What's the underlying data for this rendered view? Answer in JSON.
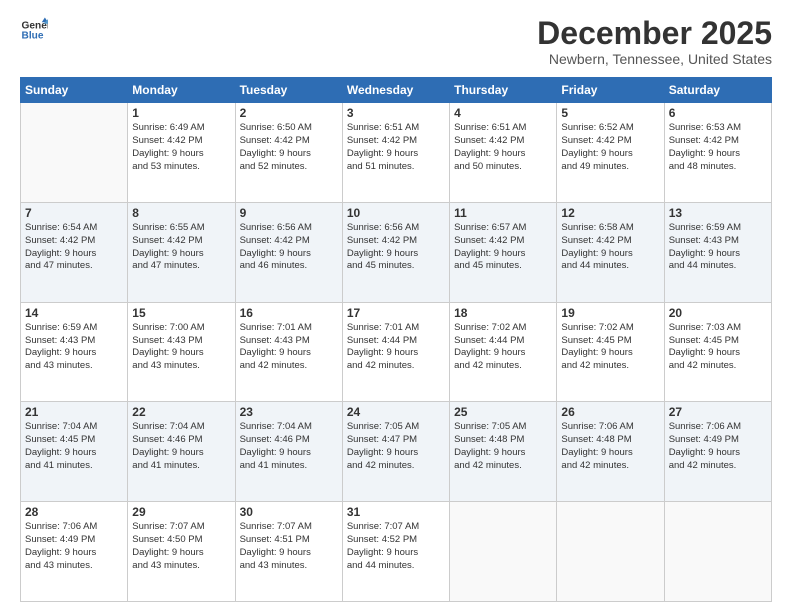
{
  "logo": {
    "line1": "General",
    "line2": "Blue"
  },
  "title": "December 2025",
  "subtitle": "Newbern, Tennessee, United States",
  "weekdays": [
    "Sunday",
    "Monday",
    "Tuesday",
    "Wednesday",
    "Thursday",
    "Friday",
    "Saturday"
  ],
  "weeks": [
    [
      {
        "day": "",
        "info": ""
      },
      {
        "day": "1",
        "info": "Sunrise: 6:49 AM\nSunset: 4:42 PM\nDaylight: 9 hours\nand 53 minutes."
      },
      {
        "day": "2",
        "info": "Sunrise: 6:50 AM\nSunset: 4:42 PM\nDaylight: 9 hours\nand 52 minutes."
      },
      {
        "day": "3",
        "info": "Sunrise: 6:51 AM\nSunset: 4:42 PM\nDaylight: 9 hours\nand 51 minutes."
      },
      {
        "day": "4",
        "info": "Sunrise: 6:51 AM\nSunset: 4:42 PM\nDaylight: 9 hours\nand 50 minutes."
      },
      {
        "day": "5",
        "info": "Sunrise: 6:52 AM\nSunset: 4:42 PM\nDaylight: 9 hours\nand 49 minutes."
      },
      {
        "day": "6",
        "info": "Sunrise: 6:53 AM\nSunset: 4:42 PM\nDaylight: 9 hours\nand 48 minutes."
      }
    ],
    [
      {
        "day": "7",
        "info": "Sunrise: 6:54 AM\nSunset: 4:42 PM\nDaylight: 9 hours\nand 47 minutes."
      },
      {
        "day": "8",
        "info": "Sunrise: 6:55 AM\nSunset: 4:42 PM\nDaylight: 9 hours\nand 47 minutes."
      },
      {
        "day": "9",
        "info": "Sunrise: 6:56 AM\nSunset: 4:42 PM\nDaylight: 9 hours\nand 46 minutes."
      },
      {
        "day": "10",
        "info": "Sunrise: 6:56 AM\nSunset: 4:42 PM\nDaylight: 9 hours\nand 45 minutes."
      },
      {
        "day": "11",
        "info": "Sunrise: 6:57 AM\nSunset: 4:42 PM\nDaylight: 9 hours\nand 45 minutes."
      },
      {
        "day": "12",
        "info": "Sunrise: 6:58 AM\nSunset: 4:42 PM\nDaylight: 9 hours\nand 44 minutes."
      },
      {
        "day": "13",
        "info": "Sunrise: 6:59 AM\nSunset: 4:43 PM\nDaylight: 9 hours\nand 44 minutes."
      }
    ],
    [
      {
        "day": "14",
        "info": "Sunrise: 6:59 AM\nSunset: 4:43 PM\nDaylight: 9 hours\nand 43 minutes."
      },
      {
        "day": "15",
        "info": "Sunrise: 7:00 AM\nSunset: 4:43 PM\nDaylight: 9 hours\nand 43 minutes."
      },
      {
        "day": "16",
        "info": "Sunrise: 7:01 AM\nSunset: 4:43 PM\nDaylight: 9 hours\nand 42 minutes."
      },
      {
        "day": "17",
        "info": "Sunrise: 7:01 AM\nSunset: 4:44 PM\nDaylight: 9 hours\nand 42 minutes."
      },
      {
        "day": "18",
        "info": "Sunrise: 7:02 AM\nSunset: 4:44 PM\nDaylight: 9 hours\nand 42 minutes."
      },
      {
        "day": "19",
        "info": "Sunrise: 7:02 AM\nSunset: 4:45 PM\nDaylight: 9 hours\nand 42 minutes."
      },
      {
        "day": "20",
        "info": "Sunrise: 7:03 AM\nSunset: 4:45 PM\nDaylight: 9 hours\nand 42 minutes."
      }
    ],
    [
      {
        "day": "21",
        "info": "Sunrise: 7:04 AM\nSunset: 4:45 PM\nDaylight: 9 hours\nand 41 minutes."
      },
      {
        "day": "22",
        "info": "Sunrise: 7:04 AM\nSunset: 4:46 PM\nDaylight: 9 hours\nand 41 minutes."
      },
      {
        "day": "23",
        "info": "Sunrise: 7:04 AM\nSunset: 4:46 PM\nDaylight: 9 hours\nand 41 minutes."
      },
      {
        "day": "24",
        "info": "Sunrise: 7:05 AM\nSunset: 4:47 PM\nDaylight: 9 hours\nand 42 minutes."
      },
      {
        "day": "25",
        "info": "Sunrise: 7:05 AM\nSunset: 4:48 PM\nDaylight: 9 hours\nand 42 minutes."
      },
      {
        "day": "26",
        "info": "Sunrise: 7:06 AM\nSunset: 4:48 PM\nDaylight: 9 hours\nand 42 minutes."
      },
      {
        "day": "27",
        "info": "Sunrise: 7:06 AM\nSunset: 4:49 PM\nDaylight: 9 hours\nand 42 minutes."
      }
    ],
    [
      {
        "day": "28",
        "info": "Sunrise: 7:06 AM\nSunset: 4:49 PM\nDaylight: 9 hours\nand 43 minutes."
      },
      {
        "day": "29",
        "info": "Sunrise: 7:07 AM\nSunset: 4:50 PM\nDaylight: 9 hours\nand 43 minutes."
      },
      {
        "day": "30",
        "info": "Sunrise: 7:07 AM\nSunset: 4:51 PM\nDaylight: 9 hours\nand 43 minutes."
      },
      {
        "day": "31",
        "info": "Sunrise: 7:07 AM\nSunset: 4:52 PM\nDaylight: 9 hours\nand 44 minutes."
      },
      {
        "day": "",
        "info": ""
      },
      {
        "day": "",
        "info": ""
      },
      {
        "day": "",
        "info": ""
      }
    ]
  ]
}
